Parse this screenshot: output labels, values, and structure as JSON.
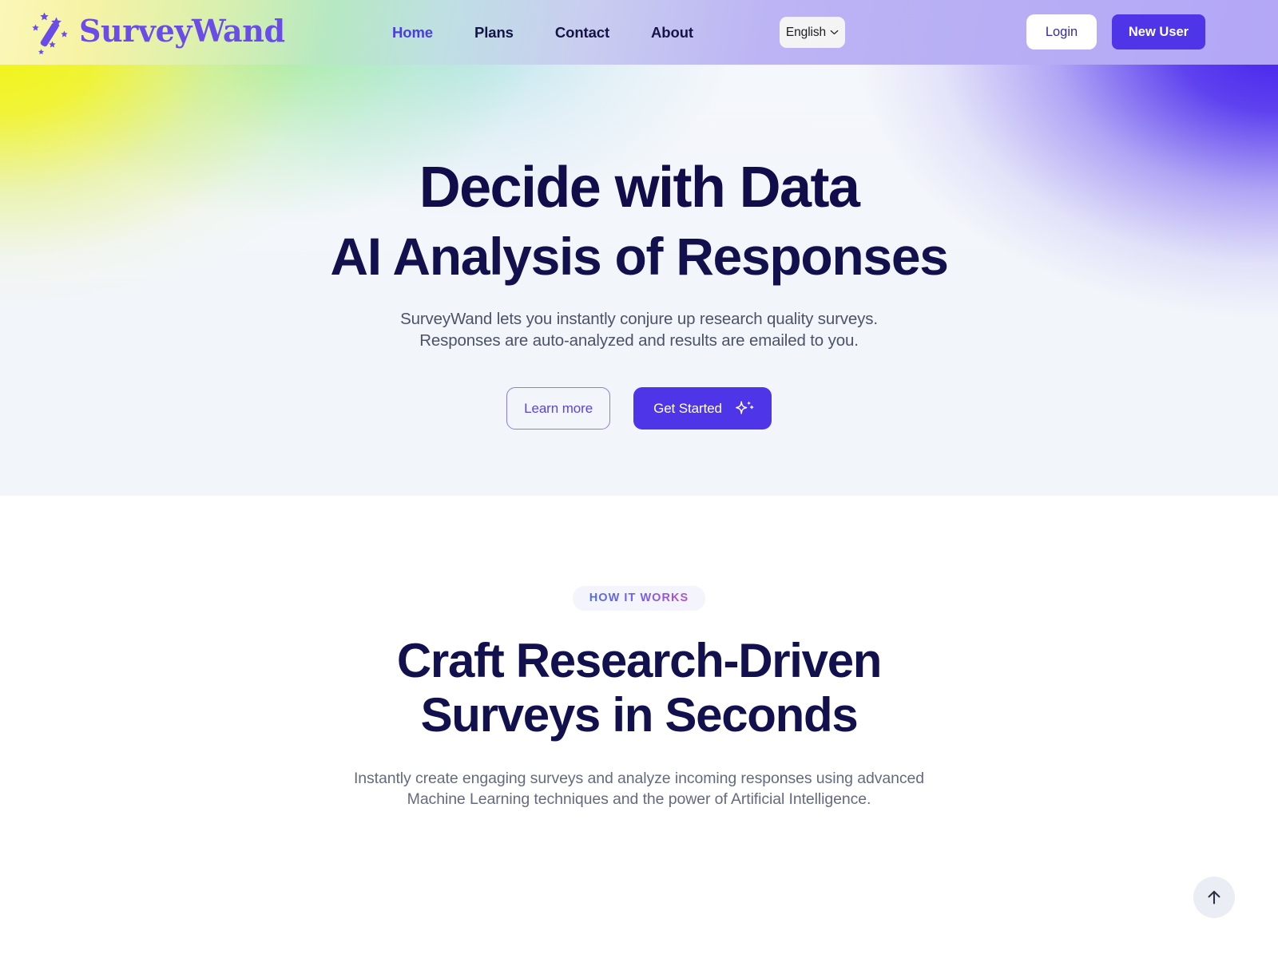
{
  "brand": {
    "name": "SurveyWand",
    "logo_icon": "magic-wand-stars-icon",
    "accent_purple": "#4f35e8",
    "logo_purple": "#6a4ce8",
    "headline_navy": "#13104e"
  },
  "header": {
    "nav": [
      {
        "label": "Home",
        "active": true
      },
      {
        "label": "Plans",
        "active": false
      },
      {
        "label": "Contact",
        "active": false
      },
      {
        "label": "About",
        "active": false
      }
    ],
    "language": {
      "selected": "English",
      "chevron_icon": "chevron-down-icon"
    },
    "login_label": "Login",
    "new_user_label": "New User"
  },
  "hero": {
    "title_line1": "Decide with Data",
    "title_line2": "AI Analysis of Responses",
    "subtitle_line1": "SurveyWand lets you  instantly conjure up research quality surveys.",
    "subtitle_line2": "Responses are auto-analyzed and results are emailed to you.",
    "learn_more_label": "Learn more",
    "get_started_label": "Get Started",
    "get_started_icon": "sparkle-icon"
  },
  "how_it_works": {
    "badge": "HOW IT WORKS",
    "heading_line1": "Craft Research-Driven",
    "heading_line2": "Surveys in Seconds",
    "body_line1": "Instantly create engaging surveys and analyze incoming responses using advanced",
    "body_line2": "Machine Learning techniques and the power of Artificial Intelligence."
  },
  "scroll_top": {
    "icon": "arrow-up-icon"
  }
}
